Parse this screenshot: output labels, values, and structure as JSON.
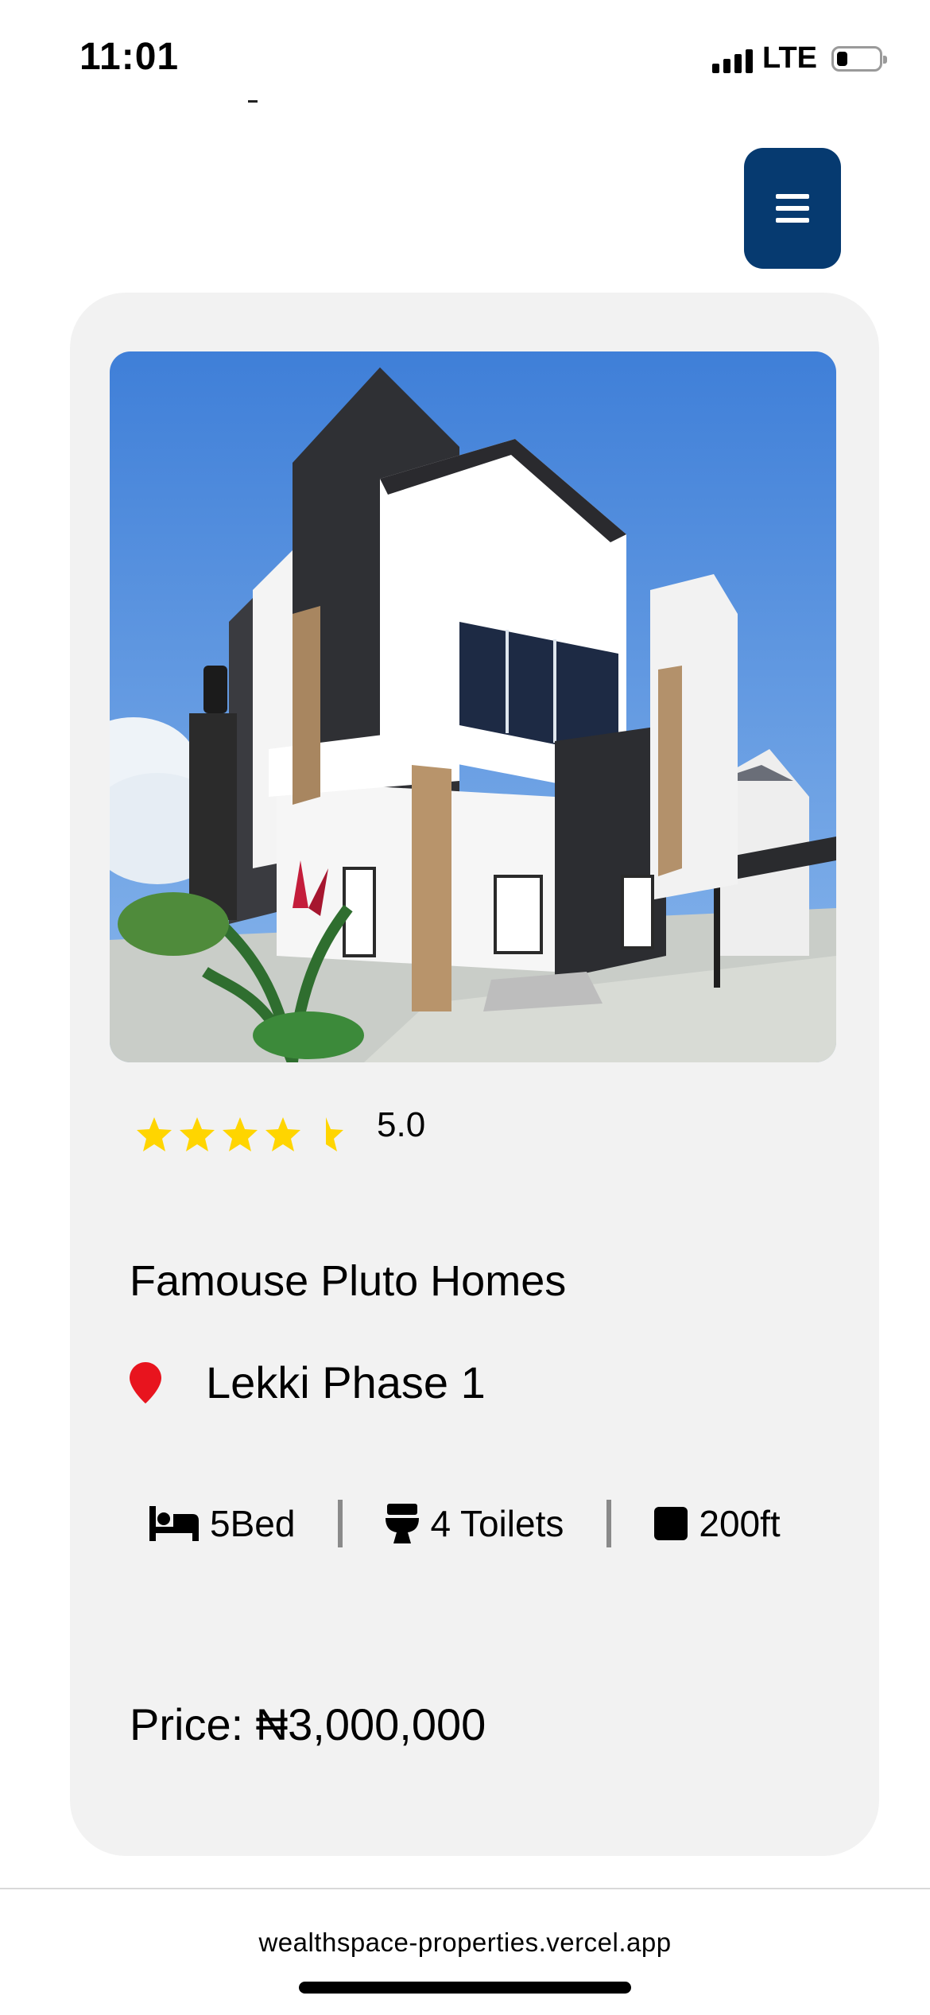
{
  "status_bar": {
    "time": "11:01",
    "network": "LTE",
    "battery_level": 0.25
  },
  "header": {
    "menu_icon": "hamburger-icon",
    "menu_color": "#063a70"
  },
  "listing": {
    "image_icon": "house-photo",
    "rating": {
      "stars_value": 4.5,
      "label": "5.0"
    },
    "title": "Famouse Pluto Homes",
    "location": "Lekki Phase 1",
    "features": {
      "beds": "5Bed",
      "toilets": "4 Toilets",
      "area": "200ft"
    },
    "price": "Price: ₦3,000,000"
  },
  "browser": {
    "url": "wealthspace-properties.vercel.app"
  },
  "colors": {
    "star": "#FFD500",
    "pin": "#E8141E",
    "card_bg": "#f2f2f2"
  }
}
